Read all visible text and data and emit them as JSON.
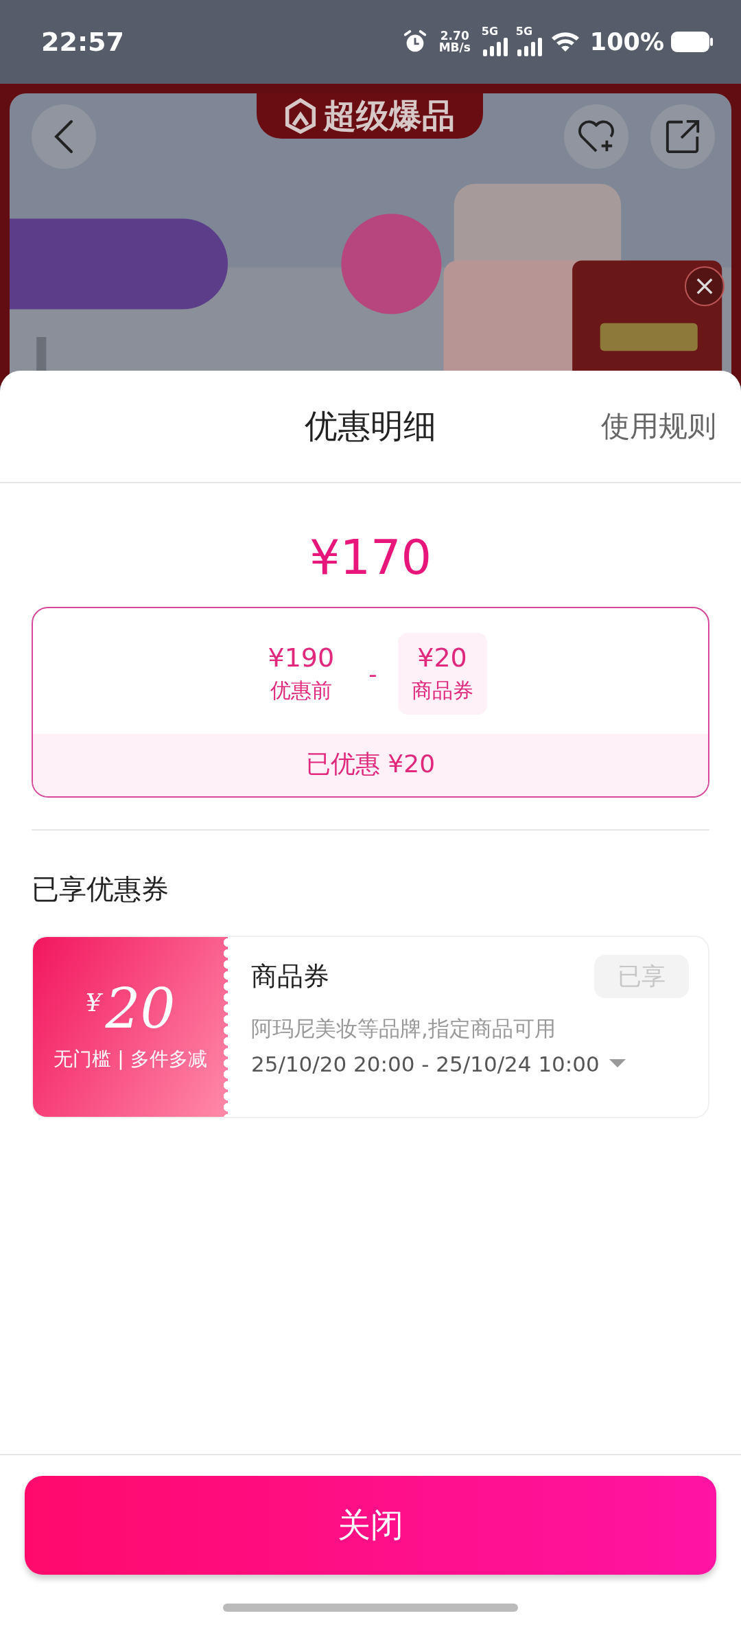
{
  "status_bar": {
    "time": "22:57",
    "net_speed": "2.70",
    "net_unit": "MB/s",
    "sim_1": "5G",
    "sim_2": "5G",
    "battery": "100%"
  },
  "hero": {
    "badge": "超级爆品"
  },
  "sheet": {
    "title": "优惠明细",
    "rules_link": "使用规则",
    "final_price": "¥170",
    "breakdown": {
      "terms": [
        {
          "amount": "¥190",
          "label": "优惠前",
          "highlighted": false
        },
        {
          "amount": "¥20",
          "label": "商品券",
          "highlighted": true
        }
      ],
      "operator": "-",
      "saved": "已优惠 ¥20"
    },
    "section_title": "已享优惠券",
    "coupons": [
      {
        "symbol": "¥",
        "amount": "20",
        "condition": "无门槛 | 多件多减",
        "name": "商品券",
        "status": "已享",
        "disabled": true,
        "description": "阿玛尼美妆等品牌,指定商品可用",
        "validity": "25/10/20 20:00 - 25/10/24 10:00"
      }
    ],
    "close_button": "关闭"
  }
}
